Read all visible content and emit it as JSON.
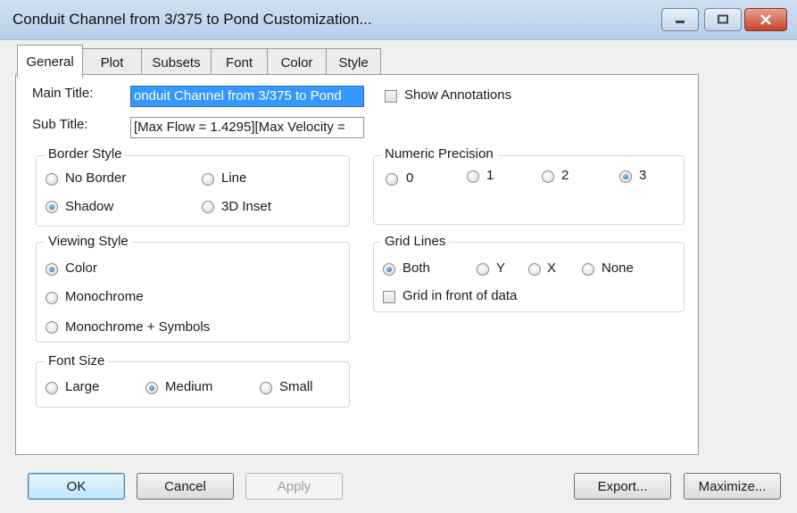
{
  "window": {
    "title": "Conduit Channel from 3/375 to Pond Customization...",
    "controls": [
      "minimize-icon",
      "maximize-icon",
      "close-icon"
    ]
  },
  "tabs": [
    {
      "label": "General",
      "active": true
    },
    {
      "label": "Plot"
    },
    {
      "label": "Subsets"
    },
    {
      "label": "Font"
    },
    {
      "label": "Color"
    },
    {
      "label": "Style"
    }
  ],
  "general": {
    "main_title_label": "Main Title:",
    "main_title_value": "onduit Channel from 3/375 to Pond",
    "sub_title_label": "Sub Title:",
    "sub_title_value": "[Max Flow = 1.4295][Max Velocity =",
    "show_annotations": {
      "label": "Show Annotations",
      "checked": false
    },
    "border_style": {
      "title": "Border Style",
      "options": [
        "No Border",
        "Line",
        "Shadow",
        "3D Inset"
      ],
      "selected": "Shadow"
    },
    "numeric_precision": {
      "title": "Numeric Precision",
      "options": [
        "0",
        "1",
        "2",
        "3"
      ],
      "selected": "3"
    },
    "viewing_style": {
      "title": "Viewing Style",
      "options": [
        "Color",
        "Monochrome",
        "Monochrome + Symbols"
      ],
      "selected": "Color"
    },
    "grid_lines": {
      "title": "Grid Lines",
      "options": [
        "Both",
        "Y",
        "X",
        "None"
      ],
      "selected": "Both",
      "grid_in_front": {
        "label": "Grid in front of data",
        "checked": false
      }
    },
    "font_size": {
      "title": "Font Size",
      "options": [
        "Large",
        "Medium",
        "Small"
      ],
      "selected": "Medium"
    }
  },
  "buttons": {
    "ok": "OK",
    "cancel": "Cancel",
    "apply": "Apply",
    "export": "Export...",
    "maximize": "Maximize..."
  }
}
